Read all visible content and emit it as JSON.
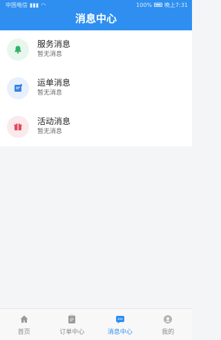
{
  "status": {
    "carrier": "中国电信",
    "signal": "‧‧‧‧",
    "battery_pct": "100%",
    "time": "晚上7:31"
  },
  "header": {
    "title": "消息中心"
  },
  "messages": [
    {
      "name": "服务消息",
      "sub": "暂无消息",
      "icon": "bell-icon",
      "color": "#32b36a",
      "bg": "#e8f7ee"
    },
    {
      "name": "运单消息",
      "sub": "暂无消息",
      "icon": "waybill-icon",
      "color": "#3b7fe0",
      "bg": "#e7f0fb"
    },
    {
      "name": "活动消息",
      "sub": "暂无消息",
      "icon": "gift-icon",
      "color": "#e4485a",
      "bg": "#fbe9ec"
    }
  ],
  "tabs": [
    {
      "label": "首页",
      "icon": "home-icon",
      "active": false
    },
    {
      "label": "订单中心",
      "icon": "clipboard-icon",
      "active": false
    },
    {
      "label": "消息中心",
      "icon": "chat-icon",
      "active": true
    },
    {
      "label": "我的",
      "icon": "profile-icon",
      "active": false
    }
  ],
  "colors": {
    "accent": "#2e8ff0"
  }
}
